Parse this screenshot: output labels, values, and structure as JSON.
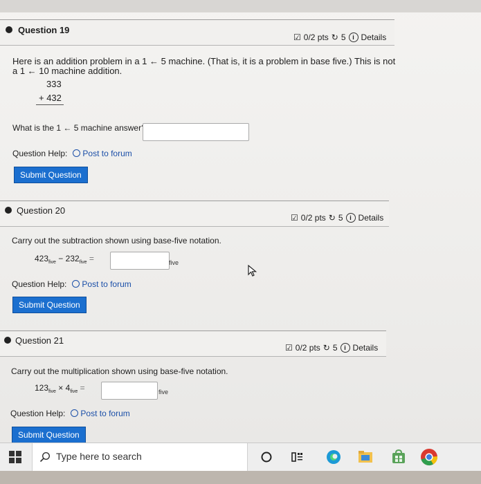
{
  "q19": {
    "title": "Question 19",
    "pts": "0/2 pts",
    "attempts": "5",
    "details": "Details",
    "line1": "Here is an addition problem in a 1 ← 5 machine. (That is, it is a problem in base five.) This is not",
    "line2": "a 1 ← 10 machine addition.",
    "top_number": "333",
    "bottom_number": "+ 432",
    "prompt": "What is the 1 ← 5 machine answer?",
    "answer_value": "",
    "help_label": "Question Help:",
    "forum_link": "Post to forum",
    "submit_label": "Submit Question"
  },
  "q20": {
    "title": "Question 20",
    "pts": "0/2 pts",
    "attempts": "5",
    "details": "Details",
    "prompt": "Carry out the subtraction shown using base-five notation.",
    "operand1": "423",
    "operand1_sub": "five",
    "operator": "−",
    "operand2": "232",
    "operand2_sub": "five",
    "equals": "=",
    "answer_value": "",
    "unit": "five",
    "help_label": "Question Help:",
    "forum_link": "Post to forum",
    "submit_label": "Submit Question"
  },
  "q21": {
    "title": "Question 21",
    "pts": "0/2 pts",
    "attempts": "5",
    "details": "Details",
    "prompt": "Carry out the multiplication shown using base-five notation.",
    "operand1": "123",
    "operand1_sub": "five",
    "operator": "×",
    "operand2": "4",
    "operand2_sub": "five",
    "equals": "=",
    "answer_value": "",
    "unit": "five",
    "help_label": "Question Help:",
    "forum_link": "Post to forum",
    "submit_label": "Submit Question"
  },
  "taskbar": {
    "search_placeholder": "Type here to search"
  }
}
